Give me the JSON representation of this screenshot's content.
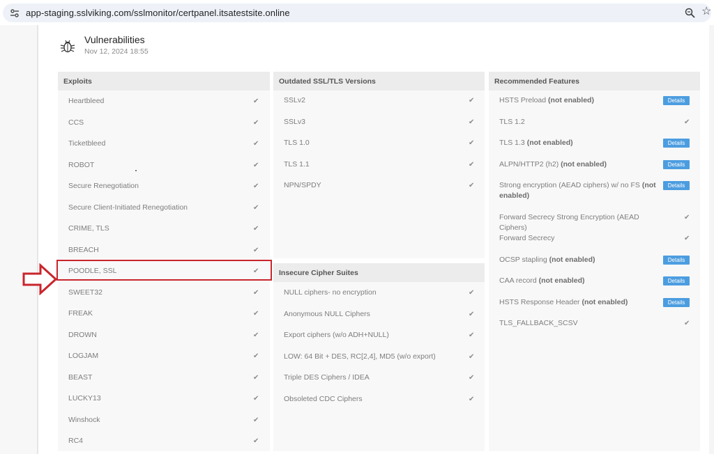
{
  "browser": {
    "url": "app-staging.sslviking.com/sslmonitor/certpanel.itsatestsite.online",
    "icons": {
      "site_info": "tune-icon",
      "zoom": "zoom-icon",
      "bookmark": "star-icon"
    }
  },
  "header": {
    "title": "Vulnerabilities",
    "date": "Nov 12, 2024 18:55",
    "icon": "bug-icon"
  },
  "exploits": {
    "title": "Exploits",
    "items": [
      {
        "label": "Heartbleed"
      },
      {
        "label": "CCS"
      },
      {
        "label": "Ticketbleed"
      },
      {
        "label": "ROBOT"
      },
      {
        "label": "Secure Renegotiation"
      },
      {
        "label": "Secure Client-Initiated Renegotiation"
      },
      {
        "label": "CRIME, TLS"
      },
      {
        "label": "BREACH"
      },
      {
        "label": "POODLE, SSL"
      },
      {
        "label": "SWEET32"
      },
      {
        "label": "FREAK"
      },
      {
        "label": "DROWN"
      },
      {
        "label": "LOGJAM"
      },
      {
        "label": "BEAST"
      },
      {
        "label": "LUCKY13"
      },
      {
        "label": "Winshock"
      },
      {
        "label": "RC4"
      }
    ]
  },
  "outdated": {
    "title": "Outdated SSL/TLS Versions",
    "items": [
      {
        "label": "SSLv2"
      },
      {
        "label": "SSLv3"
      },
      {
        "label": "TLS 1.0"
      },
      {
        "label": "TLS 1.1"
      },
      {
        "label": "NPN/SPDY"
      }
    ]
  },
  "insecure": {
    "title": "Insecure Cipher Suites",
    "items": [
      {
        "label": "NULL ciphers- no encryption"
      },
      {
        "label": "Anonymous NULL Ciphers"
      },
      {
        "label": "Export ciphers (w/o ADH+NULL)"
      },
      {
        "label": "LOW: 64 Bit + DES, RC[2,4], MD5 (w/o export)"
      },
      {
        "label": "Triple DES Ciphers / IDEA"
      },
      {
        "label": "Obsoleted CDC Ciphers"
      }
    ]
  },
  "recommended": {
    "title": "Recommended Features",
    "details_label": "Details",
    "not_enabled": "(not enabled)",
    "items": [
      {
        "label": "HSTS Preload",
        "status": "(not enabled)"
      },
      {
        "label": "TLS 1.2"
      },
      {
        "label": "TLS 1.3",
        "status": "(not enabled)"
      },
      {
        "label": "ALPN/HTTP2 (h2)",
        "status": "(not enabled)"
      },
      {
        "label": "Strong encryption (AEAD ciphers) w/ no FS",
        "status": "(not",
        "status2": "enabled)"
      },
      {
        "label": "Forward Secrecy Strong Encryption (AEAD Ciphers)"
      },
      {
        "label": "Forward Secrecy"
      },
      {
        "label": "OCSP stapling",
        "status": "(not enabled)"
      },
      {
        "label": "CAA record",
        "status": "(not enabled)"
      },
      {
        "label": "HSTS Response Header",
        "status": "(not enabled)"
      },
      {
        "label": "TLS_FALLBACK_SCSV"
      }
    ]
  },
  "check_glyph": "✔",
  "annotation": {
    "highlighted_item": "POODLE, SSL",
    "icon": "arrow-right-outline-icon",
    "color": "#c9252d"
  }
}
